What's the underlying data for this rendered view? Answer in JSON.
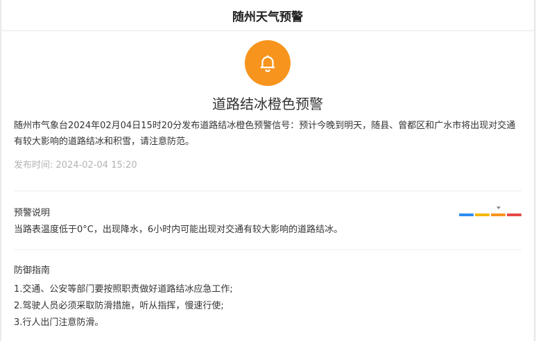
{
  "header": {
    "title": "随州天气预警"
  },
  "alert": {
    "icon": "bell-icon",
    "icon_color": "#f7941d",
    "title": "道路结冰橙色预警",
    "description": "随州市气象台2024年02月04日15时20分发布道路结冰橙色预警信号：预计今晚到明天，随县、曾都区和广水市将出现对交通有较大影响的道路结冰和积雪，请注意防范。",
    "publish_time": "发布时间: 2024-02-04 15:20"
  },
  "warning_explanation": {
    "heading": "预警说明",
    "text": "当路表温度低于0°C，出现降水，6小时内可能出现对交通有较大影响的道路结冰。",
    "levels": [
      {
        "name": "blue",
        "color": "#2d8cf0"
      },
      {
        "name": "yellow",
        "color": "#f5b700"
      },
      {
        "name": "orange",
        "color": "#f7941d"
      },
      {
        "name": "red",
        "color": "#e8474a"
      }
    ],
    "current_level_index": 2
  },
  "defense_guide": {
    "heading": "防御指南",
    "items": [
      "1.交通、公安等部门要按照职责做好道路结冰应急工作;",
      "2.驾驶人员必须采取防滑措施，听从指挥，慢速行使;",
      "3.行人出门注意防滑。"
    ]
  }
}
